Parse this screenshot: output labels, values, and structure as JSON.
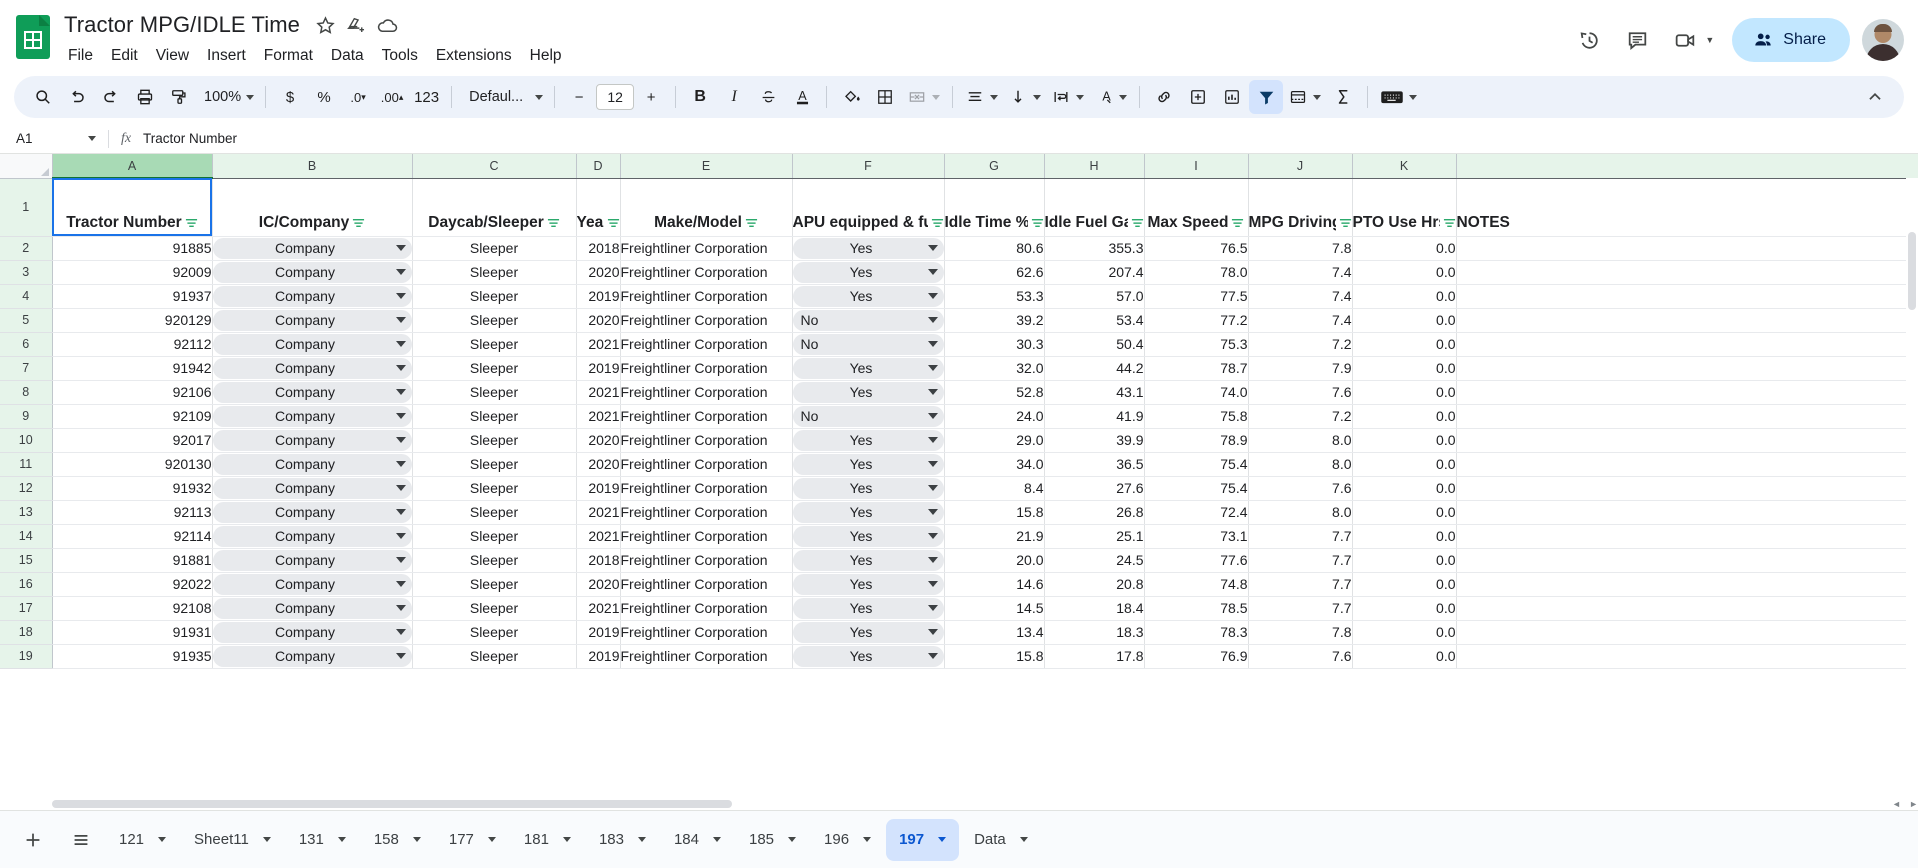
{
  "app": {
    "doc_title": "Tractor MPG/IDLE Time",
    "logo_icon": "google-sheets-icon",
    "title_icons": [
      "star-icon",
      "move-to-drive-icon",
      "cloud-saved-icon"
    ],
    "menus": [
      "File",
      "Edit",
      "View",
      "Insert",
      "Format",
      "Data",
      "Tools",
      "Extensions",
      "Help"
    ],
    "right_icons": [
      "version-history-icon",
      "comment-icon",
      "meet-camera-icon"
    ],
    "share_label": "Share",
    "share_icon": "people-icon",
    "avatar": "user-avatar"
  },
  "toolbar": {
    "zoom": "100%",
    "font": "Defaul...",
    "font_size": "12",
    "numeric_123": "123",
    "items": [
      "search-icon",
      "undo-icon",
      "redo-icon",
      "print-icon",
      "paint-format-icon",
      "currency-icon",
      "percent-icon",
      "decrease-decimal-icon",
      "increase-decimal-icon",
      "bold-icon",
      "italic-icon",
      "strikethrough-icon",
      "text-color-icon",
      "fill-color-icon",
      "borders-icon",
      "merge-cells-icon",
      "horizontal-align-icon",
      "vertical-align-icon",
      "text-wrap-icon",
      "text-rotation-icon",
      "insert-link-icon",
      "insert-comment-icon",
      "insert-chart-icon",
      "filter-icon",
      "filter-views-icon",
      "functions-icon",
      "input-tools-icon",
      "collapse-toolbar-icon"
    ],
    "active_tool": "filter-icon",
    "symbols": {
      "currency": "$",
      "percent": "%",
      "dec_minus": ".0",
      "dec_plus": ".00",
      "bold": "B",
      "italic": "I",
      "strike": "S",
      "text_color": "A",
      "sigma": "Σ",
      "minus": "−",
      "plus": "+"
    }
  },
  "formula_bar": {
    "name_box": "A1",
    "fx_label": "fx",
    "value": "Tractor Number"
  },
  "grid": {
    "column_letters": [
      "A",
      "B",
      "C",
      "D",
      "E",
      "F",
      "G",
      "H",
      "I",
      "J",
      "K",
      ""
    ],
    "selected_column": "A",
    "selected_cell": "A1",
    "row_numbers": [
      "1",
      "2",
      "3",
      "4",
      "5",
      "6",
      "7",
      "8",
      "9",
      "10",
      "11",
      "12",
      "13",
      "14",
      "15",
      "16",
      "17",
      "18",
      "19"
    ],
    "headers": [
      "Tractor Number",
      "IC/Company",
      "Daycab/Sleeper",
      "Year",
      "Make/Model",
      "APU equipped & funcional?",
      "Idle Time %",
      "Idle Fuel Gallon",
      "Max Speed",
      "MPG Driving",
      "PTO Use Hrs",
      "NOTES"
    ],
    "rows": [
      {
        "n": "2",
        "tractor": "91885",
        "ic": "Company",
        "type": "Sleeper",
        "year": "2018",
        "make": "Freightliner Corporation",
        "apu": "Yes",
        "idle_pct": "80.6",
        "idle_fuel": "355.3",
        "max_speed": "76.5",
        "mpg": "7.8",
        "pto": "0.0",
        "notes": ""
      },
      {
        "n": "3",
        "tractor": "92009",
        "ic": "Company",
        "type": "Sleeper",
        "year": "2020",
        "make": "Freightliner Corporation",
        "apu": "Yes",
        "idle_pct": "62.6",
        "idle_fuel": "207.4",
        "max_speed": "78.0",
        "mpg": "7.4",
        "pto": "0.0",
        "notes": ""
      },
      {
        "n": "4",
        "tractor": "91937",
        "ic": "Company",
        "type": "Sleeper",
        "year": "2019",
        "make": "Freightliner Corporation",
        "apu": "Yes",
        "idle_pct": "53.3",
        "idle_fuel": "57.0",
        "max_speed": "77.5",
        "mpg": "7.4",
        "pto": "0.0",
        "notes": ""
      },
      {
        "n": "5",
        "tractor": "920129",
        "ic": "Company",
        "type": "Sleeper",
        "year": "2020",
        "make": "Freightliner Corporation",
        "apu": "No",
        "idle_pct": "39.2",
        "idle_fuel": "53.4",
        "max_speed": "77.2",
        "mpg": "7.4",
        "pto": "0.0",
        "notes": ""
      },
      {
        "n": "6",
        "tractor": "92112",
        "ic": "Company",
        "type": "Sleeper",
        "year": "2021",
        "make": "Freightliner Corporation",
        "apu": "No",
        "idle_pct": "30.3",
        "idle_fuel": "50.4",
        "max_speed": "75.3",
        "mpg": "7.2",
        "pto": "0.0",
        "notes": ""
      },
      {
        "n": "7",
        "tractor": "91942",
        "ic": "Company",
        "type": "Sleeper",
        "year": "2019",
        "make": "Freightliner Corporation",
        "apu": "Yes",
        "idle_pct": "32.0",
        "idle_fuel": "44.2",
        "max_speed": "78.7",
        "mpg": "7.9",
        "pto": "0.0",
        "notes": ""
      },
      {
        "n": "8",
        "tractor": "92106",
        "ic": "Company",
        "type": "Sleeper",
        "year": "2021",
        "make": "Freightliner Corporation",
        "apu": "Yes",
        "idle_pct": "52.8",
        "idle_fuel": "43.1",
        "max_speed": "74.0",
        "mpg": "7.6",
        "pto": "0.0",
        "notes": ""
      },
      {
        "n": "9",
        "tractor": "92109",
        "ic": "Company",
        "type": "Sleeper",
        "year": "2021",
        "make": "Freightliner Corporation",
        "apu": "No",
        "idle_pct": "24.0",
        "idle_fuel": "41.9",
        "max_speed": "75.8",
        "mpg": "7.2",
        "pto": "0.0",
        "notes": ""
      },
      {
        "n": "10",
        "tractor": "92017",
        "ic": "Company",
        "type": "Sleeper",
        "year": "2020",
        "make": "Freightliner Corporation",
        "apu": "Yes",
        "idle_pct": "29.0",
        "idle_fuel": "39.9",
        "max_speed": "78.9",
        "mpg": "8.0",
        "pto": "0.0",
        "notes": ""
      },
      {
        "n": "11",
        "tractor": "920130",
        "ic": "Company",
        "type": "Sleeper",
        "year": "2020",
        "make": "Freightliner Corporation",
        "apu": "Yes",
        "idle_pct": "34.0",
        "idle_fuel": "36.5",
        "max_speed": "75.4",
        "mpg": "8.0",
        "pto": "0.0",
        "notes": ""
      },
      {
        "n": "12",
        "tractor": "91932",
        "ic": "Company",
        "type": "Sleeper",
        "year": "2019",
        "make": "Freightliner Corporation",
        "apu": "Yes",
        "idle_pct": "8.4",
        "idle_fuel": "27.6",
        "max_speed": "75.4",
        "mpg": "7.6",
        "pto": "0.0",
        "notes": ""
      },
      {
        "n": "13",
        "tractor": "92113",
        "ic": "Company",
        "type": "Sleeper",
        "year": "2021",
        "make": "Freightliner Corporation",
        "apu": "Yes",
        "idle_pct": "15.8",
        "idle_fuel": "26.8",
        "max_speed": "72.4",
        "mpg": "8.0",
        "pto": "0.0",
        "notes": ""
      },
      {
        "n": "14",
        "tractor": "92114",
        "ic": "Company",
        "type": "Sleeper",
        "year": "2021",
        "make": "Freightliner Corporation",
        "apu": "Yes",
        "idle_pct": "21.9",
        "idle_fuel": "25.1",
        "max_speed": "73.1",
        "mpg": "7.7",
        "pto": "0.0",
        "notes": ""
      },
      {
        "n": "15",
        "tractor": "91881",
        "ic": "Company",
        "type": "Sleeper",
        "year": "2018",
        "make": "Freightliner Corporation",
        "apu": "Yes",
        "idle_pct": "20.0",
        "idle_fuel": "24.5",
        "max_speed": "77.6",
        "mpg": "7.7",
        "pto": "0.0",
        "notes": ""
      },
      {
        "n": "16",
        "tractor": "92022",
        "ic": "Company",
        "type": "Sleeper",
        "year": "2020",
        "make": "Freightliner Corporation",
        "apu": "Yes",
        "idle_pct": "14.6",
        "idle_fuel": "20.8",
        "max_speed": "74.8",
        "mpg": "7.7",
        "pto": "0.0",
        "notes": ""
      },
      {
        "n": "17",
        "tractor": "92108",
        "ic": "Company",
        "type": "Sleeper",
        "year": "2021",
        "make": "Freightliner Corporation",
        "apu": "Yes",
        "idle_pct": "14.5",
        "idle_fuel": "18.4",
        "max_speed": "78.5",
        "mpg": "7.7",
        "pto": "0.0",
        "notes": ""
      },
      {
        "n": "18",
        "tractor": "91931",
        "ic": "Company",
        "type": "Sleeper",
        "year": "2019",
        "make": "Freightliner Corporation",
        "apu": "Yes",
        "idle_pct": "13.4",
        "idle_fuel": "18.3",
        "max_speed": "78.3",
        "mpg": "7.8",
        "pto": "0.0",
        "notes": ""
      },
      {
        "n": "19",
        "tractor": "91935",
        "ic": "Company",
        "type": "Sleeper",
        "year": "2019",
        "make": "Freightliner Corporation",
        "apu": "Yes",
        "idle_pct": "15.8",
        "idle_fuel": "17.8",
        "max_speed": "76.9",
        "mpg": "7.6",
        "pto": "0.0",
        "notes": ""
      }
    ]
  },
  "sheet_tabs": {
    "add_icon": "add-sheet-icon",
    "list_icon": "all-sheets-icon",
    "tabs": [
      "121",
      "Sheet11",
      "131",
      "158",
      "177",
      "181",
      "183",
      "184",
      "185",
      "196",
      "197",
      "Data"
    ],
    "active": "197"
  },
  "colors": {
    "brand_green": "#0f9d58",
    "header_green": "#e6f4ea",
    "selected_col_green": "#a8dab5",
    "accent_blue": "#1a73e8",
    "active_tab_blue": "#d3e3fd",
    "chip_grey": "#e8eaed",
    "share_blue": "#c2e7ff"
  }
}
